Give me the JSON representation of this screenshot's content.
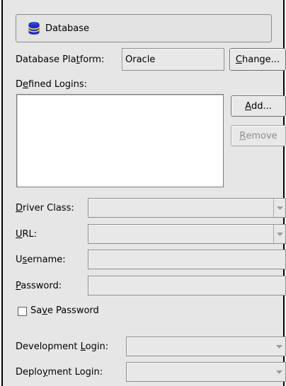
{
  "header": {
    "title": "Database",
    "icon": "database-icon"
  },
  "platform": {
    "label_pre": "Database Pla",
    "label_u": "t",
    "label_post": "form:",
    "value": "Oracle",
    "change_pre": "",
    "change_u": "C",
    "change_post": "hange..."
  },
  "logins": {
    "label_pre": "D",
    "label_u": "e",
    "label_post": "fined Logins:",
    "add_pre": "",
    "add_u": "A",
    "add_post": "dd...",
    "remove_pre": "",
    "remove_u": "R",
    "remove_post": "emove",
    "items": []
  },
  "driver": {
    "label_pre": "",
    "label_u": "D",
    "label_post": "river Class:",
    "value": ""
  },
  "url": {
    "label_pre": "",
    "label_u": "U",
    "label_post": "RL:",
    "value": ""
  },
  "username": {
    "label_pre": "U",
    "label_u": "s",
    "label_post": "ername:",
    "value": ""
  },
  "password": {
    "label_pre": "",
    "label_u": "P",
    "label_post": "assword:",
    "value": ""
  },
  "save_password": {
    "label_pre": "Sa",
    "label_u": "v",
    "label_post": "e Password",
    "checked": false
  },
  "development": {
    "label_pre": "Development ",
    "label_u": "L",
    "label_post": "ogin:",
    "value": ""
  },
  "deployment": {
    "label_pre": "Deplo",
    "label_u": "y",
    "label_post": "ment Login:",
    "value": ""
  },
  "colors": {
    "panel": "#e6e6e6",
    "disabled_text": "#8c8c8c",
    "icon_blue": "#1f2fd0"
  }
}
